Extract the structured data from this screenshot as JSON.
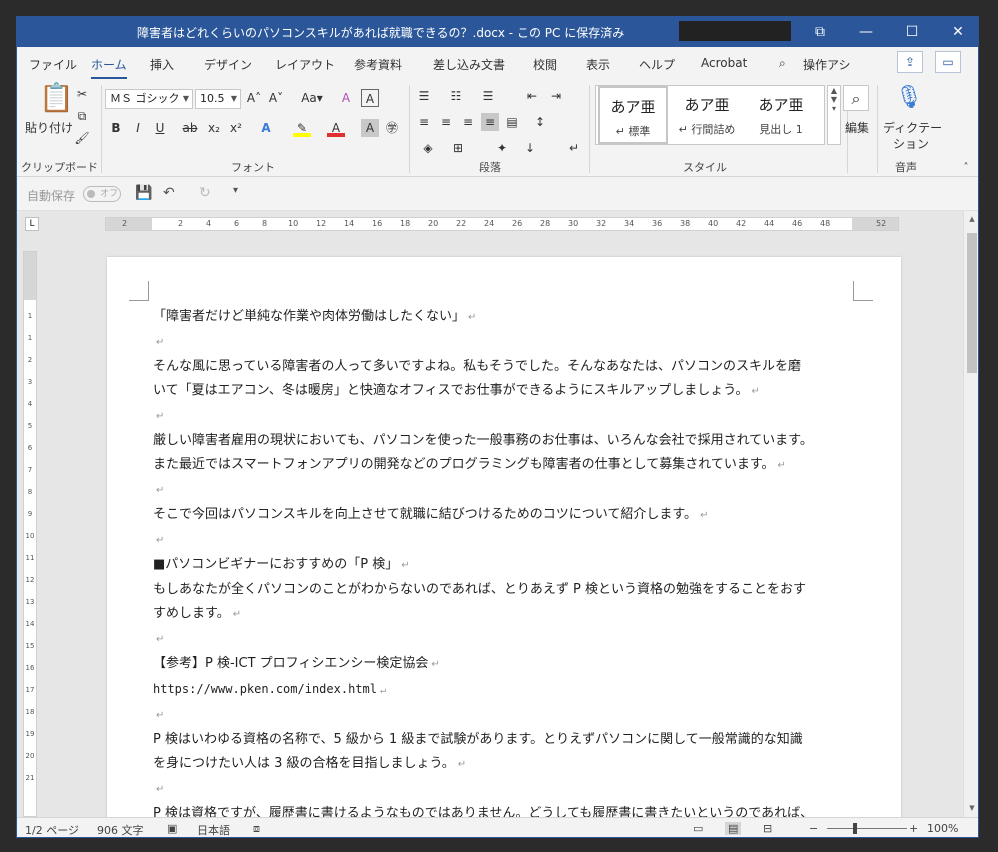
{
  "window": {
    "title": "障害者はどれくらいのパソコンスキルがあれば就職できるの？.docx - この PC に保存済み",
    "controls": [
      "⧉",
      "—",
      "☐",
      "✕"
    ]
  },
  "tabs": [
    "ファイル",
    "ホーム",
    "挿入",
    "デザイン",
    "レイアウト",
    "参考資料",
    "差し込み文書",
    "校閲",
    "表示",
    "ヘルプ",
    "Acrobat",
    "操作アシ"
  ],
  "active_tab": "ホーム",
  "ribbon": {
    "clipboard": {
      "paste_label": "貼り付け",
      "group_label": "クリップボード"
    },
    "font": {
      "name": "ＭＳ ゴシック",
      "size": "10.5",
      "group_label": "フォント"
    },
    "paragraph": {
      "group_label": "段落"
    },
    "styles": {
      "items": [
        {
          "sample": "あア亜",
          "name": "↵ 標準"
        },
        {
          "sample": "あア亜",
          "name": "↵ 行間詰め"
        },
        {
          "sample": "あア亜",
          "name": "見出し 1"
        }
      ],
      "group_label": "スタイル"
    },
    "editing": {
      "label": "編集"
    },
    "voice": {
      "label_line1": "ディクテー",
      "label_line2": "ション",
      "group_label": "音声"
    }
  },
  "qat": {
    "autosave_label": "自動保存",
    "toggle_label": "オフ"
  },
  "ruler": {
    "h_ticks": [
      "2",
      "2",
      "4",
      "6",
      "8",
      "10",
      "12",
      "14",
      "16",
      "18",
      "20",
      "22",
      "24",
      "26",
      "28",
      "30",
      "32",
      "34",
      "36",
      "38",
      "40",
      "42",
      "44",
      "46",
      "48",
      "52"
    ]
  },
  "document": {
    "paragraphs": [
      "「障害者だけど単純な作業や肉体労働はしたくない」",
      "",
      "そんな風に思っている障害者の人って多いですよね。私もそうでした。そんなあなたは、パソコンのスキルを磨",
      "いて「夏はエアコン、冬は暖房」と快適なオフィスでお仕事ができるようにスキルアップしましょう。",
      "",
      "厳しい障害者雇用の現状においても、パソコンを使った一般事務のお仕事は、いろんな会社で採用されています。",
      "また最近ではスマートフォンアプリの開発などのプログラミングも障害者の仕事として募集されています。",
      "",
      "そこで今回はパソコンスキルを向上させて就職に結びつけるためのコツについて紹介します。",
      "",
      "■パソコンビギナーにおすすめの「P 検」",
      "もしあなたが全くパソコンのことがわからないのであれば、とりあえず P 検という資格の勉強をすることをおす",
      "すめします。",
      "",
      "【参考】P 検-ICT プロフィシエンシー検定協会",
      "https://www.pken.com/index.html",
      "",
      "P 検はいわゆる資格の名称で、5 級から 1 級まで試験があります。とりえずパソコンに関して一般常識的な知識",
      "を身につけたい人は 3 級の合格を目指しましょう。",
      "",
      "P 検は資格ですが、履歴書に書けるようなものではありません。どうしても履歴書に書きたいというのであれば、"
    ],
    "paragraph_mark": "↵"
  },
  "status": {
    "page": "1/2 ページ",
    "words": "906 文字",
    "language": "日本語",
    "zoom": "100%"
  },
  "colors": {
    "accent": "#2b579a"
  }
}
